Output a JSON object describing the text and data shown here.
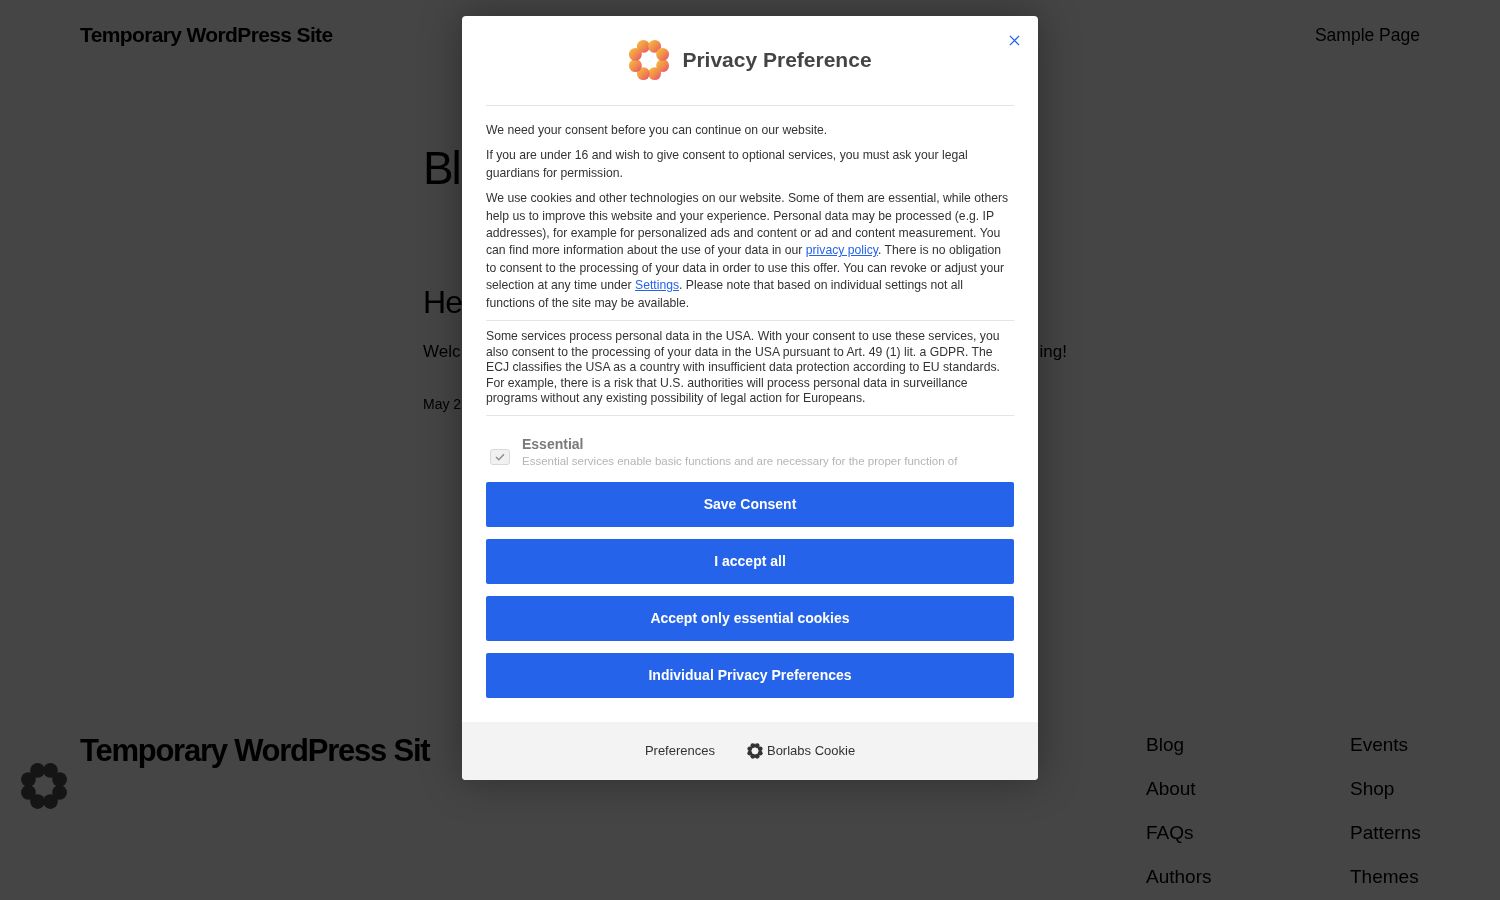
{
  "site_header": {
    "title": "Temporary WordPress Site",
    "nav": [
      "Sample Page"
    ]
  },
  "page_content": {
    "heading": "Bl",
    "post_title": "He",
    "excerpt_start": "Welc",
    "excerpt_end": "ing!",
    "date": "May 2"
  },
  "site_footer": {
    "title": "Temporary WordPress Sit",
    "nav_columns": [
      [
        "Blog",
        "About",
        "FAQs",
        "Authors"
      ],
      [
        "Events",
        "Shop",
        "Patterns",
        "Themes"
      ]
    ]
  },
  "dialog": {
    "title": "Privacy Preference",
    "paragraphs": [
      [
        {
          "kind": "text",
          "text": "We need your consent before you can continue on our website."
        }
      ],
      [
        {
          "kind": "text",
          "text": "If you are under 16 and wish to give consent to optional services, you must ask your legal guardians for permission."
        }
      ],
      [
        {
          "kind": "text",
          "text": "We use cookies and other technologies on our website. Some of them are essential, while others help us to improve this website and your experience. Personal data may be processed (e.g. IP addresses), for example for personalized ads and content or ad and content measurement. You can find more information about the use of your data in our "
        },
        {
          "kind": "link",
          "text": "privacy policy"
        },
        {
          "kind": "text",
          "text": ". There is no obligation to consent to the processing of your data in order to use this offer. You can revoke or adjust your selection at any time under "
        },
        {
          "kind": "link",
          "text": "Settings"
        },
        {
          "kind": "text",
          "text": ". Please note that based on individual settings not all functions of the site may be available."
        }
      ]
    ],
    "notice": "Some services process personal data in the USA. With your consent to use these services, you also consent to the processing of your data in the USA pursuant to Art. 49 (1) lit. a GDPR. The ECJ classifies the USA as a country with insufficient data protection according to EU standards. For example, there is a risk that U.S. authorities will process personal data in surveillance programs without any existing possibility of legal action for Europeans.",
    "groups": [
      {
        "label": "Essential",
        "description": "Essential services enable basic functions and are necessary for the proper function of",
        "checked": true
      }
    ],
    "buttons": [
      "Save Consent",
      "I accept all",
      "Accept only essential cookies",
      "Individual Privacy Preferences"
    ],
    "footer_links": [
      {
        "kind": "link",
        "text": "Preferences"
      },
      {
        "kind": "brand",
        "text": "Borlabs Cookie"
      }
    ]
  }
}
